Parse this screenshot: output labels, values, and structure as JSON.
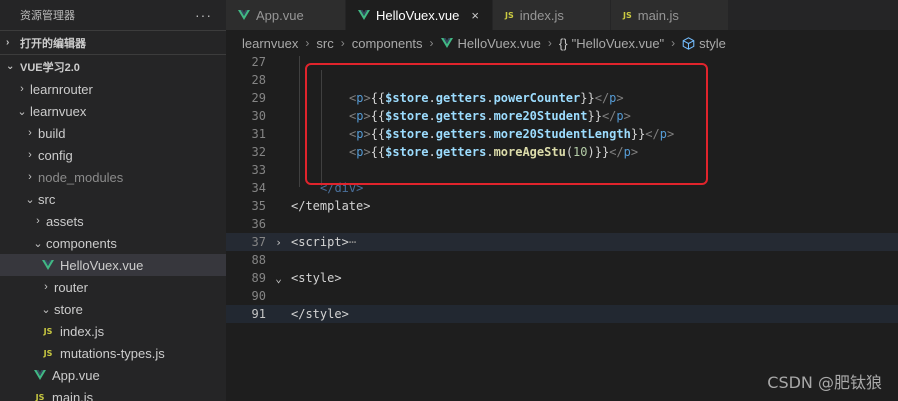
{
  "explorer": {
    "title": "资源管理器",
    "more": "···",
    "open_editors_label": "打开的编辑器",
    "workspace_label": "VUE学习2.0",
    "tree": [
      {
        "label": "learnrouter",
        "chevron": "›",
        "icon": "folder-icon"
      },
      {
        "label": "learnvuex",
        "chevron": "⌄",
        "icon": "folder-icon"
      },
      {
        "label": "build",
        "chevron": "›",
        "icon": "folder-icon"
      },
      {
        "label": "config",
        "chevron": "›",
        "icon": "folder-icon"
      },
      {
        "label": "node_modules",
        "chevron": "›",
        "icon": "folder-icon"
      },
      {
        "label": "src",
        "chevron": "⌄",
        "icon": "folder-icon"
      },
      {
        "label": "assets",
        "chevron": "›",
        "icon": "folder-icon"
      },
      {
        "label": "components",
        "chevron": "⌄",
        "icon": "folder-icon"
      },
      {
        "label": "HelloVuex.vue",
        "icon": "vue-icon"
      },
      {
        "label": "router",
        "chevron": "›",
        "icon": "folder-icon"
      },
      {
        "label": "store",
        "chevron": "⌄",
        "icon": "folder-icon"
      },
      {
        "label": "index.js",
        "icon": "js-icon"
      },
      {
        "label": "mutations-types.js",
        "icon": "js-icon"
      },
      {
        "label": "App.vue",
        "icon": "vue-icon"
      },
      {
        "label": "main.js",
        "icon": "js-icon"
      }
    ]
  },
  "tabs": [
    {
      "label": "App.vue",
      "icon": "vue-icon"
    },
    {
      "label": "HelloVuex.vue",
      "icon": "vue-icon",
      "close": "×"
    },
    {
      "label": "index.js",
      "icon": "js-icon",
      "badge": "JS"
    },
    {
      "label": "main.js",
      "icon": "js-icon",
      "badge": "JS"
    }
  ],
  "breadcrumb": {
    "items": [
      "learnvuex",
      "src",
      "components",
      "HelloVuex.vue",
      "\"HelloVuex.vue\"",
      "style"
    ],
    "braces": "{}",
    "sep": "›"
  },
  "editor": {
    "line_numbers": [
      "27",
      "28",
      "29",
      "30",
      "31",
      "32",
      "33",
      "34",
      "35",
      "36",
      "37",
      "88",
      "89",
      "90",
      "91"
    ],
    "lines": {
      "l29": {
        "open": "<",
        "p": "p",
        "close": ">",
        "lb": "{{",
        "store": "$store",
        "dot": ".",
        "getters": "getters",
        "prop": "powerCounter",
        "rb": "}}",
        "end_open": "</",
        "end_close": ">"
      },
      "l30": {
        "prop": "more20Student"
      },
      "l31": {
        "prop": "more20StudentLength"
      },
      "l32": {
        "prop": "moreAgeStu",
        "paren_open": "(",
        "arg": "10",
        "paren_close": ")"
      },
      "l34": {
        "text": "</div>"
      },
      "l35": {
        "open": "</",
        "name": "template",
        "close": ">"
      },
      "l37": {
        "open": "<",
        "name": "script",
        "close": ">",
        "ellipsis": "⋯"
      },
      "l89": {
        "open": "<",
        "name": "style",
        "close": ">"
      },
      "l91": {
        "open": "</",
        "name": "style",
        "close": ">"
      }
    },
    "fold_open": "⌄",
    "fold_closed": "›"
  },
  "watermark": "CSDN @肥钛狼",
  "colors": {
    "vue_green": "#41b883",
    "js_yellow": "#cbcb41",
    "annotation_red": "#e0242c"
  }
}
